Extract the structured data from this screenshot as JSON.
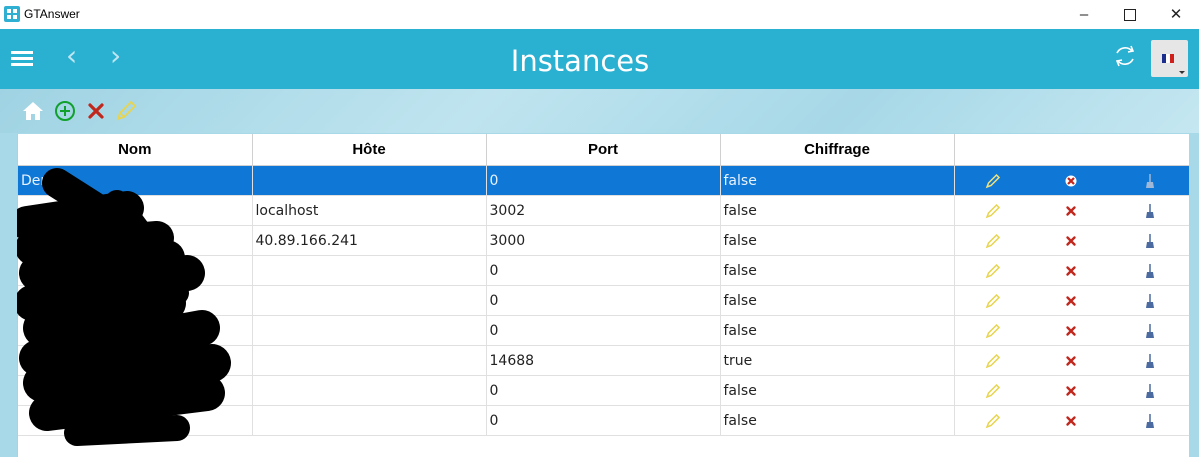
{
  "window": {
    "title": "GTAnswer",
    "minimize": "–",
    "close": "✕"
  },
  "header": {
    "title": "Instances",
    "back": "‹",
    "forward": "›"
  },
  "toolbar": {
    "icons": [
      "home-icon",
      "add-icon",
      "delete-icon",
      "edit-icon"
    ]
  },
  "table": {
    "columns": [
      "Nom",
      "Hôte",
      "Port",
      "Chiffrage"
    ],
    "rows": [
      {
        "nom": "Demo",
        "hote": "",
        "port": "0",
        "chiffrage": "false",
        "selected": true
      },
      {
        "nom": "",
        "hote": "localhost",
        "port": "3002",
        "chiffrage": "false"
      },
      {
        "nom": "",
        "hote": "40.89.166.241",
        "port": "3000",
        "chiffrage": "false"
      },
      {
        "nom": "",
        "hote": "",
        "port": "0",
        "chiffrage": "false"
      },
      {
        "nom": "",
        "hote": "",
        "port": "0",
        "chiffrage": "false"
      },
      {
        "nom": "",
        "hote": "",
        "port": "0",
        "chiffrage": "false"
      },
      {
        "nom": "",
        "hote": "",
        "port": "14688",
        "chiffrage": "true"
      },
      {
        "nom": "",
        "hote": "",
        "port": "0",
        "chiffrage": "false"
      },
      {
        "nom": "",
        "hote": "",
        "port": "0",
        "chiffrage": "false"
      }
    ]
  },
  "colors": {
    "header": "#2ab0d0",
    "selected_row": "#0f78d6",
    "delete": "#c0281e",
    "edit": "#e8d44d"
  }
}
